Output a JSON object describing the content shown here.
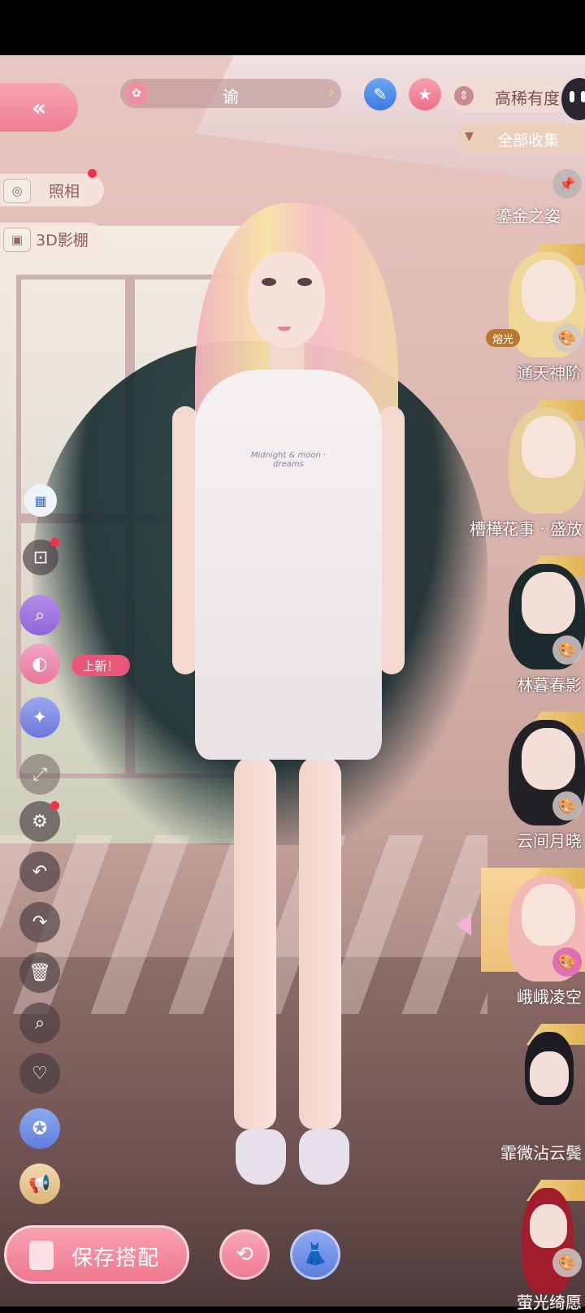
{
  "header": {
    "outfit_name": "谕",
    "sort_label": "高稀有度",
    "category_label": "全部收集"
  },
  "side_menu": {
    "photo_label": "照相",
    "studio_label": "3D影棚",
    "new_tag": "上新！"
  },
  "garment_print_text": "Midnight & moon · dreams",
  "hair_list": {
    "glow_badge": "熔光",
    "partial_item_label": "鎏金之姿",
    "items": [
      {
        "label": "通天神阶"
      },
      {
        "label": "槽樺花事 · 盛放"
      },
      {
        "label": "林暮春影"
      },
      {
        "label": "云间月晓"
      },
      {
        "label": "峨峨凌空"
      },
      {
        "label": "霏微沾云鬓"
      },
      {
        "label": "萤光绮愿"
      }
    ]
  },
  "bottom": {
    "save_label": "保存搭配"
  },
  "icons": {
    "back": "double-chevron-left-icon",
    "pen": "pen-icon",
    "star": "star-icon",
    "camera": "camera-icon",
    "box": "box-3d-icon",
    "palette": "palette-icon",
    "settings": "gear-icon",
    "undo": "undo-icon",
    "redo": "redo-icon",
    "delete": "trash-icon",
    "search": "search-icon",
    "favorite": "heart-icon"
  },
  "colors": {
    "accent_pink": "#ef7e94",
    "tag_gold": "#e2b358",
    "notify_red": "#f23147"
  }
}
